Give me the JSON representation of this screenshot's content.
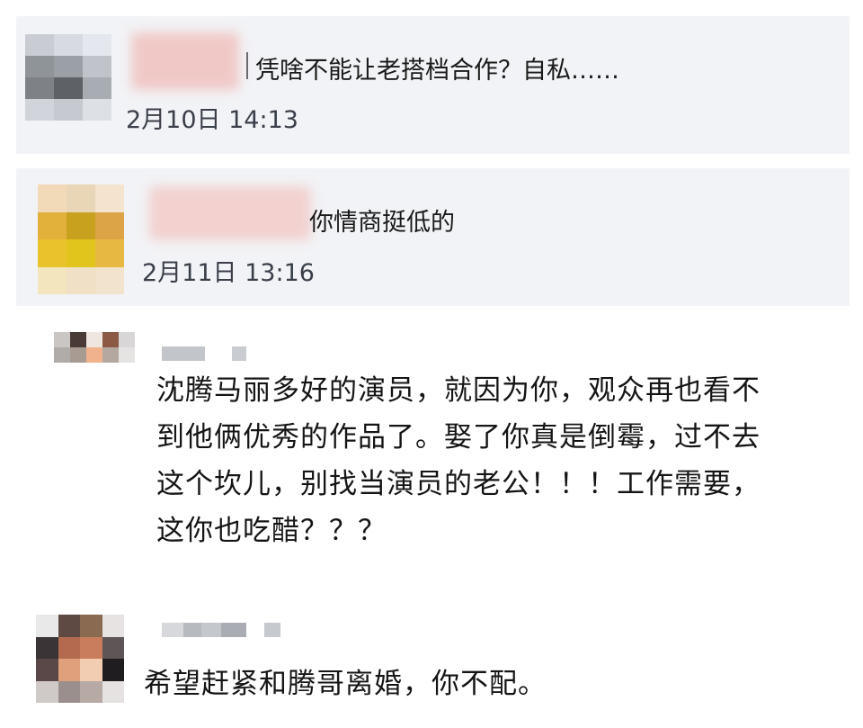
{
  "comments": [
    {
      "text": "凭啥不能让老搭档合作？自私……",
      "time": "2月10日 14:13"
    },
    {
      "text": "你情商挺低的",
      "time": "2月11日 13:16"
    },
    {
      "lines": [
        "沈腾马丽多好的演员，就因为你，观众再也看不",
        "到他俩优秀的作品了。娶了你真是倒霉，过不去",
        "这个坎儿，别找当演员的老公！！！工作需要，",
        "这你也吃醋？？？"
      ]
    },
    {
      "text": "希望赶紧和腾哥离婚，你不配。"
    }
  ]
}
